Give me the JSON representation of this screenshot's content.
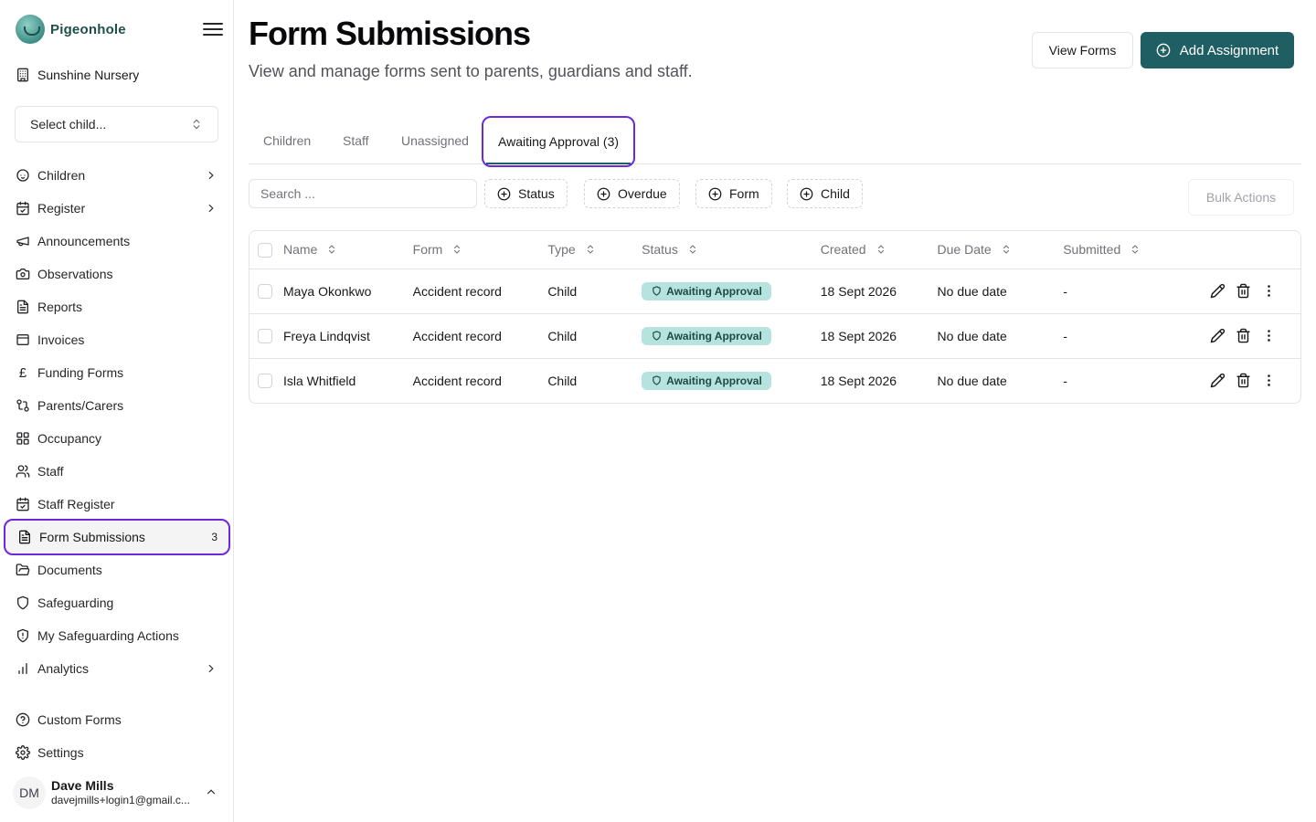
{
  "sidebar": {
    "brand": "Pigeonhole",
    "nursery": "Sunshine Nursery",
    "select_child": "Select child...",
    "items": [
      {
        "label": "Children"
      },
      {
        "label": "Register"
      },
      {
        "label": "Announcements"
      },
      {
        "label": "Observations"
      },
      {
        "label": "Reports"
      },
      {
        "label": "Invoices"
      },
      {
        "label": "Funding Forms"
      },
      {
        "label": "Parents/Carers"
      },
      {
        "label": "Occupancy"
      },
      {
        "label": "Staff"
      },
      {
        "label": "Staff Register"
      },
      {
        "label": "Form Submissions",
        "count": "3"
      },
      {
        "label": "Documents"
      },
      {
        "label": "Safeguarding"
      },
      {
        "label": "My Safeguarding Actions"
      },
      {
        "label": "Analytics"
      },
      {
        "label": "Custom Forms"
      },
      {
        "label": "Settings"
      }
    ],
    "user": {
      "initials": "DM",
      "name": "Dave Mills",
      "email": "davejmills+login1@gmail.c..."
    }
  },
  "header": {
    "title": "Form Submissions",
    "subtitle": "View and manage forms sent to parents, guardians and staff.",
    "view_forms": "View Forms",
    "add_assignment": "Add Assignment"
  },
  "tabs": [
    {
      "label": "Children"
    },
    {
      "label": "Staff"
    },
    {
      "label": "Unassigned"
    },
    {
      "label": "Awaiting Approval (3)"
    }
  ],
  "toolbar": {
    "search_placeholder": "Search ...",
    "filters": [
      "Status",
      "Overdue",
      "Form",
      "Child"
    ],
    "bulk_actions": "Bulk Actions"
  },
  "table": {
    "columns": [
      "Name",
      "Form",
      "Type",
      "Status",
      "Created",
      "Due Date",
      "Submitted"
    ],
    "rows": [
      {
        "name": "Maya Okonkwo",
        "form": "Accident record",
        "type": "Child",
        "status": "Awaiting Approval",
        "created": "18 Sept 2026",
        "due": "No due date",
        "submitted": "-"
      },
      {
        "name": "Freya Lindqvist",
        "form": "Accident record",
        "type": "Child",
        "status": "Awaiting Approval",
        "created": "18 Sept 2026",
        "due": "No due date",
        "submitted": "-"
      },
      {
        "name": "Isla Whitfield",
        "form": "Accident record",
        "type": "Child",
        "status": "Awaiting Approval",
        "created": "18 Sept 2026",
        "due": "No due date",
        "submitted": "-"
      }
    ]
  },
  "colors": {
    "primary": "#1f5f63",
    "highlight": "#6d28d9",
    "badge_bg": "#b7e3de"
  }
}
